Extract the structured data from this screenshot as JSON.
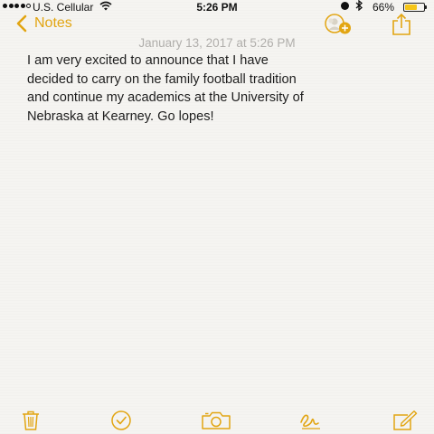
{
  "status_bar": {
    "carrier": "U.S. Cellular",
    "time": "5:26 PM",
    "battery_percent": "66%",
    "battery_level": 0.66,
    "signal_bars_filled": 4,
    "signal_bars_total": 5,
    "icons": [
      "signal-dots-icon",
      "wifi-icon",
      "alarm-icon",
      "bluetooth-icon",
      "battery-icon"
    ]
  },
  "nav": {
    "back_label": "Notes",
    "accent_color": "#e2a512",
    "icons": [
      "chevron-left-icon",
      "add-people-icon",
      "share-icon"
    ]
  },
  "note": {
    "date": "January 13, 2017 at 5:26 PM",
    "lines": [
      "I am very excited to announce that I have",
      "decided to carry on the family football tradition",
      "and continue my academics at the University of",
      "Nebraska at Kearney. Go lopes!"
    ]
  },
  "toolbar": {
    "icons": [
      "trash-icon",
      "checklist-icon",
      "camera-icon",
      "sketch-icon",
      "compose-icon"
    ]
  }
}
